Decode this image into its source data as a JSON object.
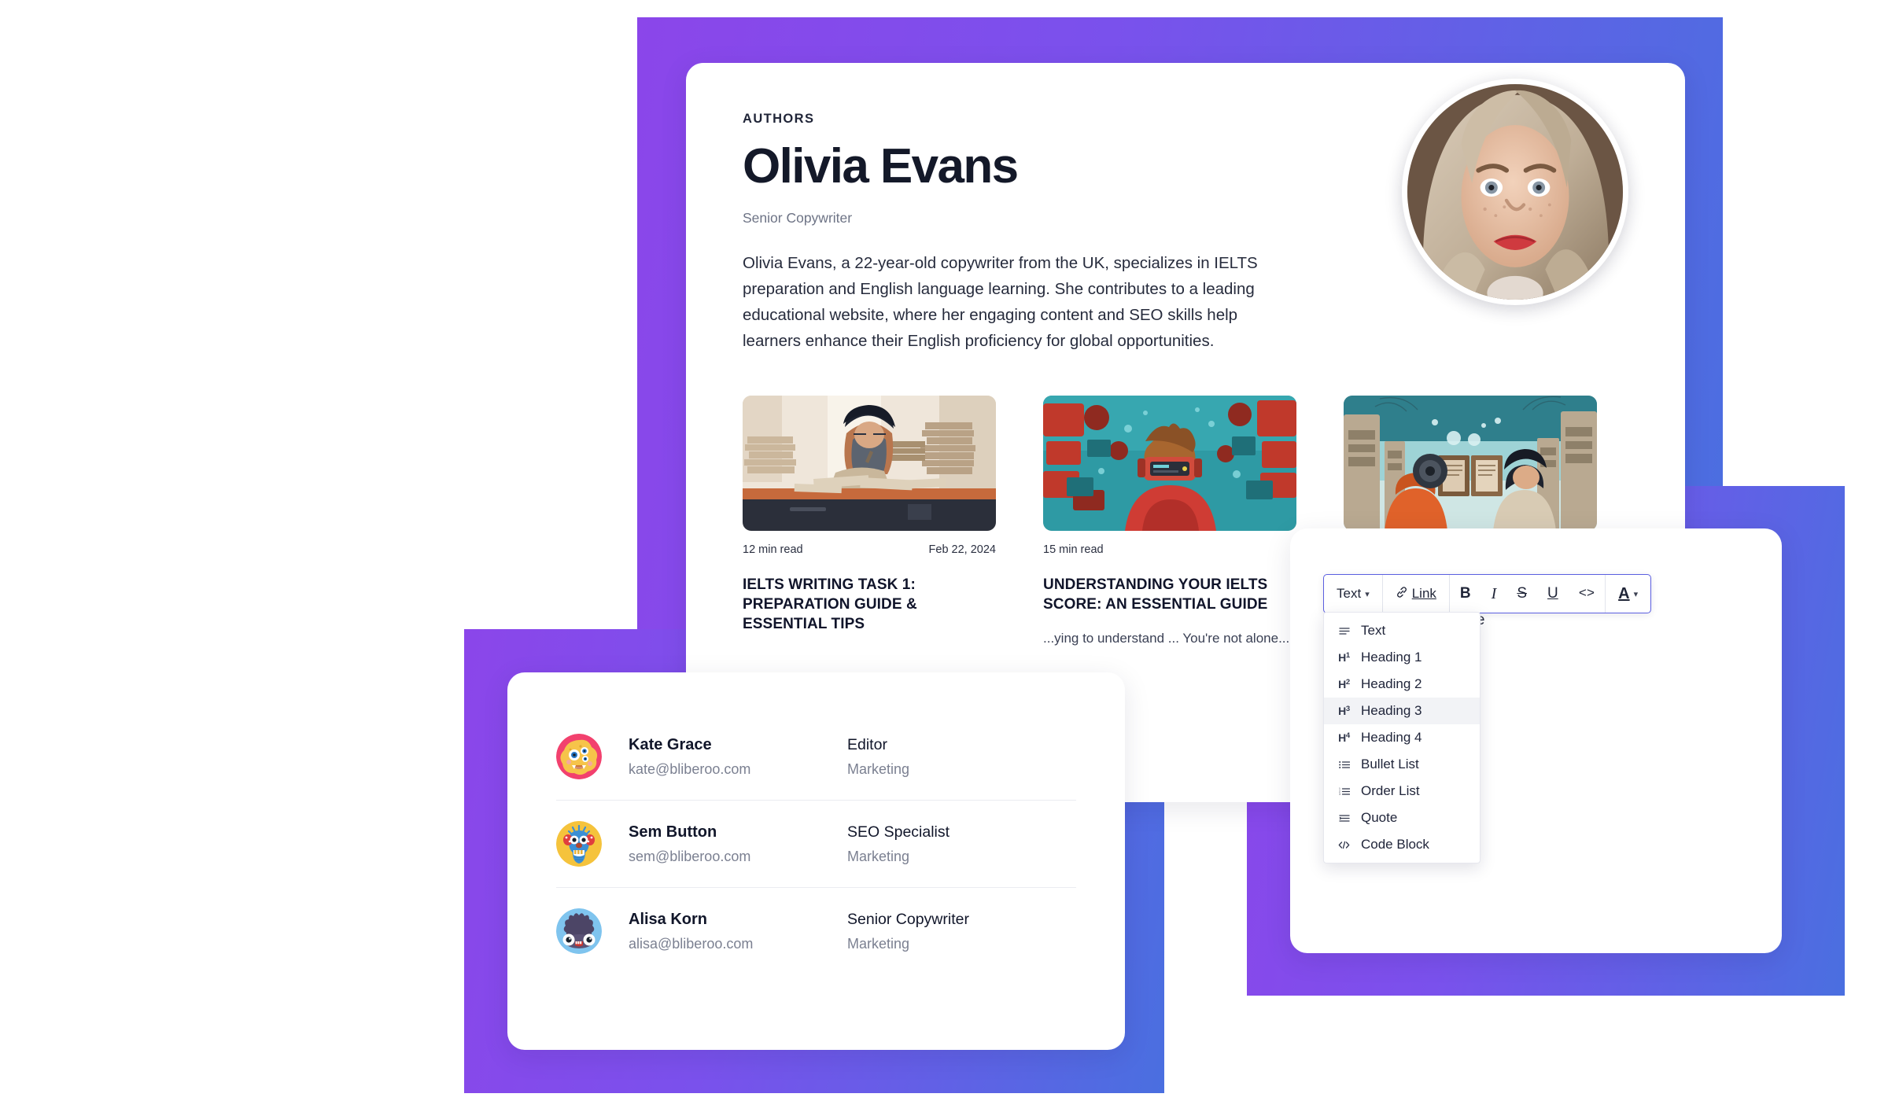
{
  "authors_card": {
    "eyebrow": "AUTHORS",
    "name": "Olivia Evans",
    "role": "Senior Copywriter",
    "bio": "Olivia Evans, a 22-year-old copywriter from the UK, specializes in IELTS preparation and English language learning. She contributes to a leading educational website, where her engaging content and SEO skills help learners enhance their English proficiency for global opportunities.",
    "photo_alt": "portrait of blonde woman",
    "articles": [
      {
        "read_time": "12 min read",
        "date": "Feb 22, 2024",
        "title": "IELTS WRITING TASK 1: PREPARATION GUIDE & ESSENTIAL TIPS",
        "excerpt": "",
        "thumb_alt": "illustration of student writing at desk surrounded by stacks of paper"
      },
      {
        "read_time": "15 min read",
        "date": "",
        "title": "UNDERSTANDING YOUR IELTS SCORE: AN ESSENTIAL GUIDE",
        "excerpt": "...ying to understand ... You're not alone...",
        "thumb_alt": "illustration of person in red hoodie wearing vr headset amid red machinery"
      },
      {
        "read_time": "",
        "date": "",
        "title": "",
        "excerpt": "",
        "thumb_alt": "illustration of two figures reading books in teal cyber library"
      }
    ]
  },
  "team_card": {
    "members": [
      {
        "name": "Kate Grace",
        "email": "kate@bliberoo.com",
        "title": "Editor",
        "department": "Marketing",
        "avatar": "monster-yellow-three-eyes",
        "avatar_bg": "#F2416E",
        "avatar_fg": "#F6C44A"
      },
      {
        "name": "Sem Button",
        "email": "sem@bliberoo.com",
        "title": "SEO Specialist",
        "department": "Marketing",
        "avatar": "monster-blue-horned",
        "avatar_bg": "#F5C33C",
        "avatar_fg": "#3C8FD4"
      },
      {
        "name": "Alisa Korn",
        "email": "alisa@bliberoo.com",
        "title": "Senior Copywriter",
        "department": "Marketing",
        "avatar": "monster-purple-fluffy",
        "avatar_bg": "#7FC4EE",
        "avatar_fg": "#4C4566"
      }
    ]
  },
  "editor_card": {
    "body_text": "ere",
    "toolbar": {
      "style_label": "Text",
      "link_label": "Link",
      "bold_label": "B",
      "italic_label": "I",
      "strike_label": "S",
      "underline_label": "U",
      "code_label": "<>",
      "color_label": "A"
    },
    "dropdown": {
      "items": [
        {
          "label": "Text",
          "icon": "paragraph-icon",
          "active": false
        },
        {
          "label": "Heading 1",
          "icon": "h1-icon",
          "active": false
        },
        {
          "label": "Heading 2",
          "icon": "h2-icon",
          "active": false
        },
        {
          "label": "Heading 3",
          "icon": "h3-icon",
          "active": true
        },
        {
          "label": "Heading 4",
          "icon": "h4-icon",
          "active": false
        },
        {
          "label": "Bullet List",
          "icon": "bullet-list-icon",
          "active": false
        },
        {
          "label": "Order List",
          "icon": "order-list-icon",
          "active": false
        },
        {
          "label": "Quote",
          "icon": "quote-icon",
          "active": false
        },
        {
          "label": "Code Block",
          "icon": "code-block-icon",
          "active": false
        }
      ]
    }
  },
  "theme": {
    "gradient_start": "#8B46EA",
    "gradient_end": "#4A6FE0",
    "accent_border": "#5B5FE0",
    "text_dark": "#11162A",
    "text_muted": "#7B8091"
  }
}
